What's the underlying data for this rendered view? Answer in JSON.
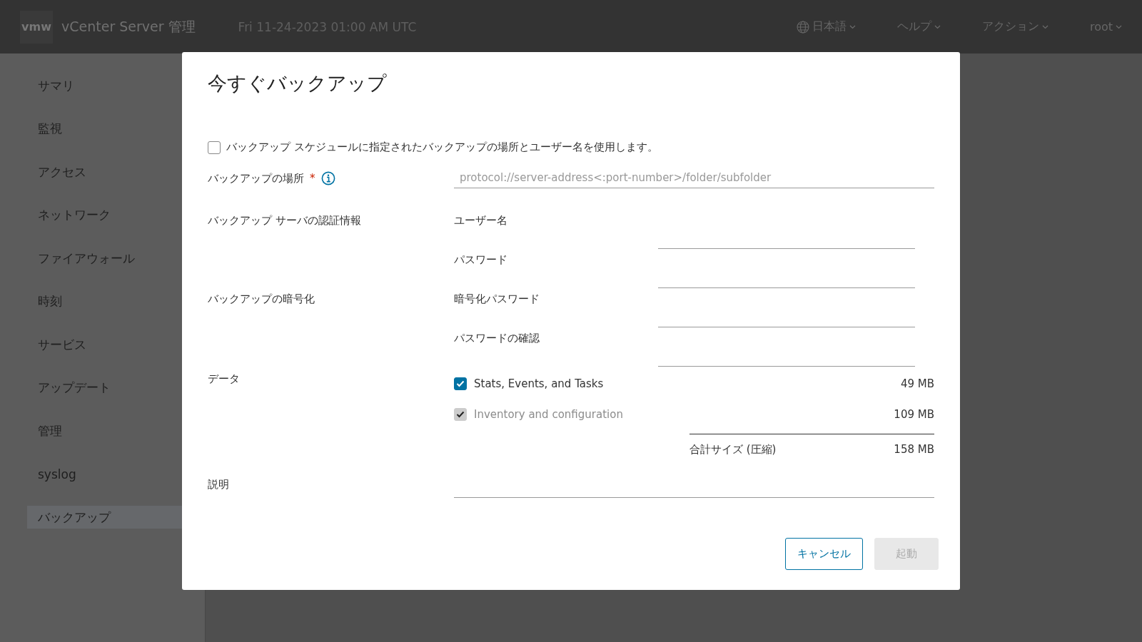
{
  "header": {
    "logo": "vmw",
    "title": "vCenter Server 管理",
    "datetime": "Fri 11-24-2023 01:00 AM UTC",
    "menus": [
      {
        "kind": "language",
        "label": "日本語"
      },
      {
        "kind": "plain",
        "label": "ヘルプ"
      },
      {
        "kind": "plain",
        "label": "アクション"
      },
      {
        "kind": "plain",
        "label": "root"
      }
    ]
  },
  "sidebar": {
    "items": [
      {
        "label": "サマリ",
        "selected": false
      },
      {
        "label": "監視",
        "selected": false
      },
      {
        "label": "アクセス",
        "selected": false
      },
      {
        "label": "ネットワーク",
        "selected": false
      },
      {
        "label": "ファイアウォール",
        "selected": false
      },
      {
        "label": "時刻",
        "selected": false
      },
      {
        "label": "サービス",
        "selected": false
      },
      {
        "label": "アップデート",
        "selected": false
      },
      {
        "label": "管理",
        "selected": false
      },
      {
        "label": "syslog",
        "selected": false
      },
      {
        "label": "バックアップ",
        "selected": true
      }
    ]
  },
  "dialog": {
    "title": "今すぐバックアップ",
    "schedule_checkbox": {
      "label": "バックアップ スケジュールに指定されたバックアップの場所とユーザー名を使用します。",
      "checked": false
    },
    "location": {
      "label": "バックアップの場所",
      "required_mark": "*",
      "placeholder": "protocol://server-address<:port-number>/folder/subfolder"
    },
    "credentials": {
      "label": "バックアップ サーバの認証情報",
      "fields": [
        {
          "label": "ユーザー名"
        },
        {
          "label": "パスワード"
        }
      ]
    },
    "encryption": {
      "label": "バックアップの暗号化",
      "fields": [
        {
          "label": "暗号化パスワード"
        },
        {
          "label": "パスワードの確認"
        }
      ]
    },
    "data": {
      "label": "データ",
      "items": [
        {
          "label": "Stats, Events, and Tasks",
          "size": "49 MB",
          "checked": true,
          "disabled": false
        },
        {
          "label": "Inventory and configuration",
          "size": "109 MB",
          "checked": true,
          "disabled": true
        }
      ],
      "total_label": "合計サイズ (圧縮)",
      "total_size": "158 MB"
    },
    "description": {
      "label": "説明"
    },
    "buttons": [
      {
        "label": "キャンセル",
        "kind": "secondary",
        "disabled": false
      },
      {
        "label": "起動",
        "kind": "primary",
        "disabled": true
      }
    ]
  }
}
